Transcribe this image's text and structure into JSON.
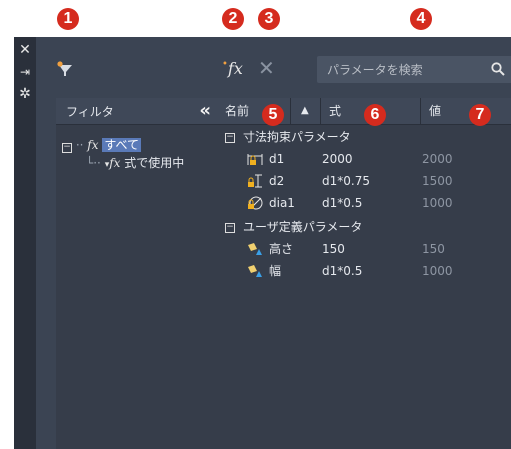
{
  "callouts": [
    "1",
    "2",
    "3",
    "4",
    "5",
    "6",
    "7"
  ],
  "toolbar": {
    "filter_icon": "filter-icon",
    "new_param_icon": "fx",
    "delete_icon": "close-icon",
    "search_placeholder": "パラメータを検索",
    "search_icon": "search-icon"
  },
  "titlebar": {
    "icons": [
      "close-icon",
      "auto-hide-icon",
      "settings-icon"
    ]
  },
  "filter": {
    "header": "フィルタ",
    "collapse": "«",
    "tree": [
      {
        "fx": "fx",
        "label": "すべて",
        "selected": true
      },
      {
        "fx": "fx",
        "label": "式で使用中",
        "selected": false
      }
    ]
  },
  "grid": {
    "columns": [
      {
        "label": "名前"
      },
      {
        "label": "▲"
      },
      {
        "label": "式"
      },
      {
        "label": "値"
      }
    ],
    "groups": [
      {
        "label": "寸法拘束パラメータ",
        "rows": [
          {
            "icon": "linear-dimension-icon",
            "name": "d1",
            "expr": "2000",
            "value": "2000"
          },
          {
            "icon": "vertical-dimension-icon",
            "name": "d2",
            "expr": "d1*0.75",
            "value": "1500"
          },
          {
            "icon": "diameter-dimension-icon",
            "name": "dia1",
            "expr": "d1*0.5",
            "value": "1000"
          }
        ]
      },
      {
        "label": "ユーザ定義パラメータ",
        "rows": [
          {
            "icon": "user-parameter-icon",
            "name": "高さ",
            "expr": "150",
            "value": "150"
          },
          {
            "icon": "user-parameter-icon",
            "name": "幅",
            "expr": "d1*0.5",
            "value": "1000"
          }
        ]
      }
    ]
  },
  "colors": {
    "panel": "#3b4453",
    "callout": "#d52b1e",
    "selected": "#5a7ab8"
  }
}
